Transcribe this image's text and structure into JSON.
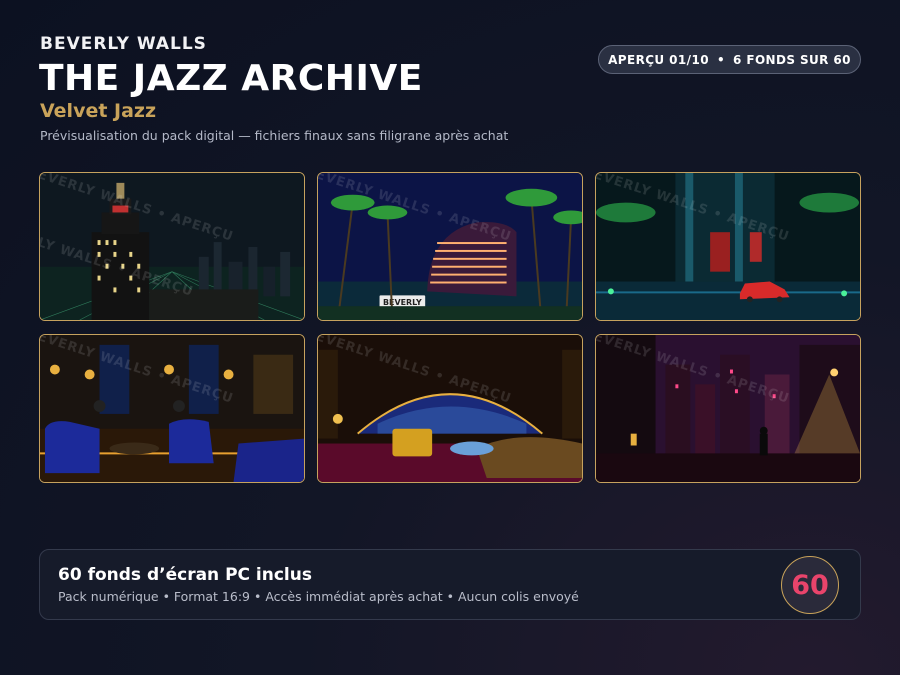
{
  "header": {
    "brand": "BEVERLY WALLS",
    "title": "THE JAZZ ARCHIVE",
    "subtitle": "Velvet Jazz",
    "description": "Prévisualisation du pack digital — fichiers finaux sans filigrane après achat"
  },
  "badge": {
    "preview": "APERÇU 01/10",
    "separator": "•",
    "count": "6 FONDS SUR 60"
  },
  "thumbnails": [
    {
      "watermark": "BEVERLY WALLS • APERÇU"
    },
    {
      "watermark": "BEVERLY WALLS • APERÇU",
      "sign": "BEVERLY"
    },
    {
      "watermark": "BEVERLY WALLS • APERÇU"
    },
    {
      "watermark": "BEVERLY WALLS • APERÇU"
    },
    {
      "watermark": "BEVERLY WALLS • APERÇU"
    },
    {
      "watermark": "BEVERLY WALLS • APERÇU"
    }
  ],
  "footer": {
    "title": "60 fonds d’écran PC inclus",
    "subtitle": "Pack numérique • Format 16:9 • Accès immédiat après achat • Aucun colis envoyé",
    "count": "60"
  },
  "colors": {
    "accent_gold": "#c9a35a",
    "count_pink": "#e9446b",
    "background": "#0c1121"
  }
}
